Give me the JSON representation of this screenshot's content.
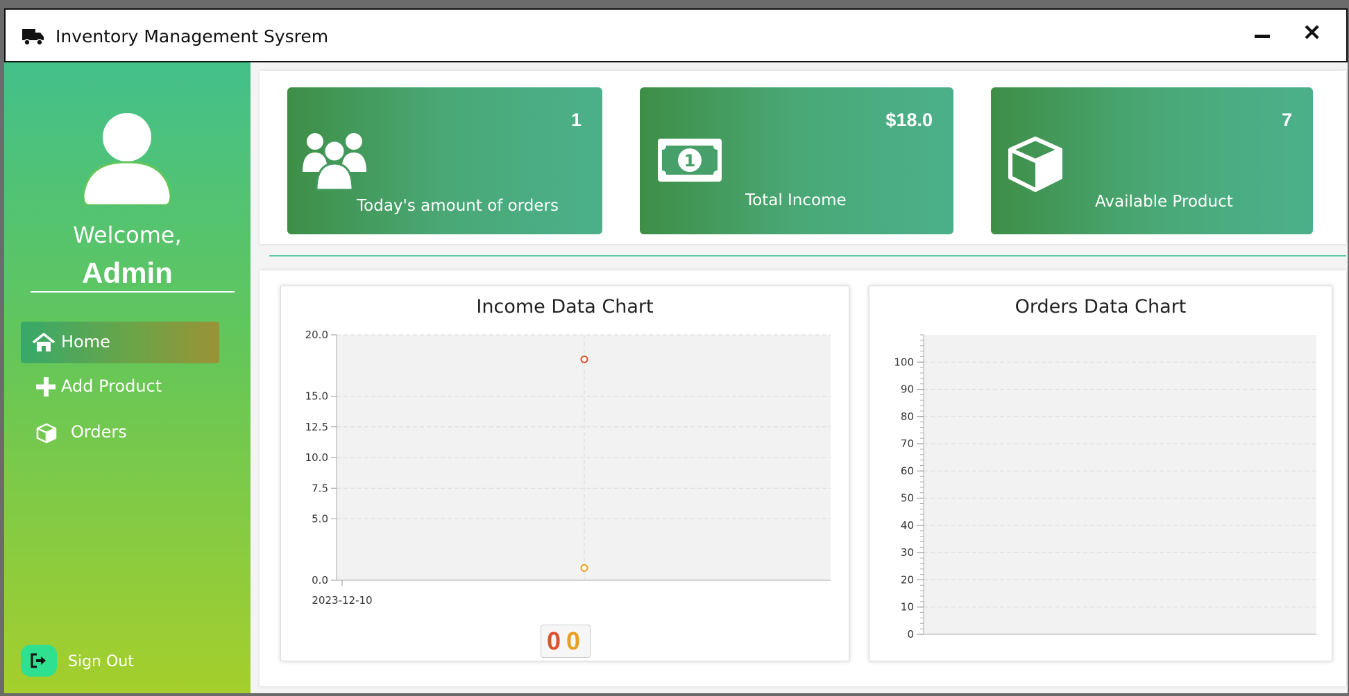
{
  "window": {
    "title": "Inventory Management Sysrem"
  },
  "sidebar": {
    "welcome": "Welcome,",
    "username": "Admin",
    "items": [
      {
        "label": "Home",
        "icon": "home-icon",
        "active": true
      },
      {
        "label": "Add Product",
        "icon": "plus-icon"
      },
      {
        "label": "Orders",
        "icon": "cube-icon"
      }
    ],
    "signout": "Sign Out"
  },
  "cards": [
    {
      "value": "1",
      "label": "Today's amount of orders",
      "icon": "users-icon"
    },
    {
      "value": "$18.0",
      "label": "Total Income",
      "icon": "money-icon"
    },
    {
      "value": "7",
      "label": "Available Product",
      "icon": "cube-icon"
    }
  ],
  "colors": {
    "accent": "#4aa876",
    "sidebar_top": "#43c08a",
    "sidebar_bottom": "#a5cf2c",
    "point_red": "#d9532c",
    "point_orange": "#e8a020"
  },
  "chart_data": [
    {
      "type": "scatter",
      "title": "Income Data Chart",
      "x": [
        "2023-12-10",
        "2023-12-10"
      ],
      "series": [
        {
          "color": "#d9532c",
          "values": [
            18.0
          ]
        },
        {
          "color": "#e8a020",
          "values": [
            1.0
          ]
        }
      ],
      "ylim": [
        0,
        20
      ],
      "yticks": [
        "0.0",
        "5.0",
        "7.5",
        "10.0",
        "12.5",
        "15.0",
        "20.0"
      ],
      "xticks": [
        "2023-12-10"
      ],
      "legend": [
        "0",
        "0"
      ],
      "grid": true
    },
    {
      "type": "bar",
      "title": "Orders Data Chart",
      "categories": [],
      "values": [],
      "ylim": [
        0,
        110
      ],
      "yticks": [
        "0",
        "10",
        "20",
        "30",
        "40",
        "50",
        "60",
        "70",
        "80",
        "90",
        "100"
      ],
      "grid": true
    }
  ]
}
